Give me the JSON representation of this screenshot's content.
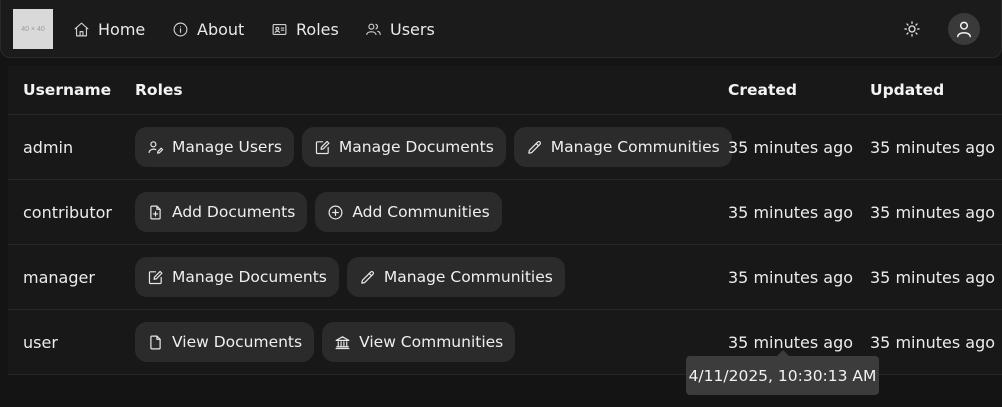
{
  "navbar": {
    "logo_text": "40 × 40",
    "items": [
      {
        "label": "Home",
        "icon": "home-icon"
      },
      {
        "label": "About",
        "icon": "info-icon"
      },
      {
        "label": "Roles",
        "icon": "id-card-icon"
      },
      {
        "label": "Users",
        "icon": "users-icon"
      }
    ],
    "theme_toggle_icon": "sun-icon",
    "avatar_icon": "user-icon"
  },
  "table": {
    "columns": [
      "Username",
      "Roles",
      "Created",
      "Updated"
    ],
    "rows": [
      {
        "username": "admin",
        "roles": [
          {
            "label": "Manage Users",
            "icon": "user-edit-icon"
          },
          {
            "label": "Manage Documents",
            "icon": "edit-square-icon"
          },
          {
            "label": "Manage Communities",
            "icon": "pencil-icon"
          }
        ],
        "created": "35 minutes ago",
        "updated": "35 minutes ago"
      },
      {
        "username": "contributor",
        "roles": [
          {
            "label": "Add Documents",
            "icon": "file-plus-icon"
          },
          {
            "label": "Add Communities",
            "icon": "circle-plus-icon"
          }
        ],
        "created": "35 minutes ago",
        "updated": "35 minutes ago"
      },
      {
        "username": "manager",
        "roles": [
          {
            "label": "Manage Documents",
            "icon": "edit-square-icon"
          },
          {
            "label": "Manage Communities",
            "icon": "pencil-icon"
          }
        ],
        "created": "35 minutes ago",
        "updated": "35 minutes ago"
      },
      {
        "username": "user",
        "roles": [
          {
            "label": "View Documents",
            "icon": "file-icon"
          },
          {
            "label": "View Communities",
            "icon": "building-icon"
          }
        ],
        "created": "35 minutes ago",
        "updated": "35 minutes ago"
      }
    ]
  },
  "tooltip": {
    "text": "4/11/2025, 10:30:13 AM"
  }
}
